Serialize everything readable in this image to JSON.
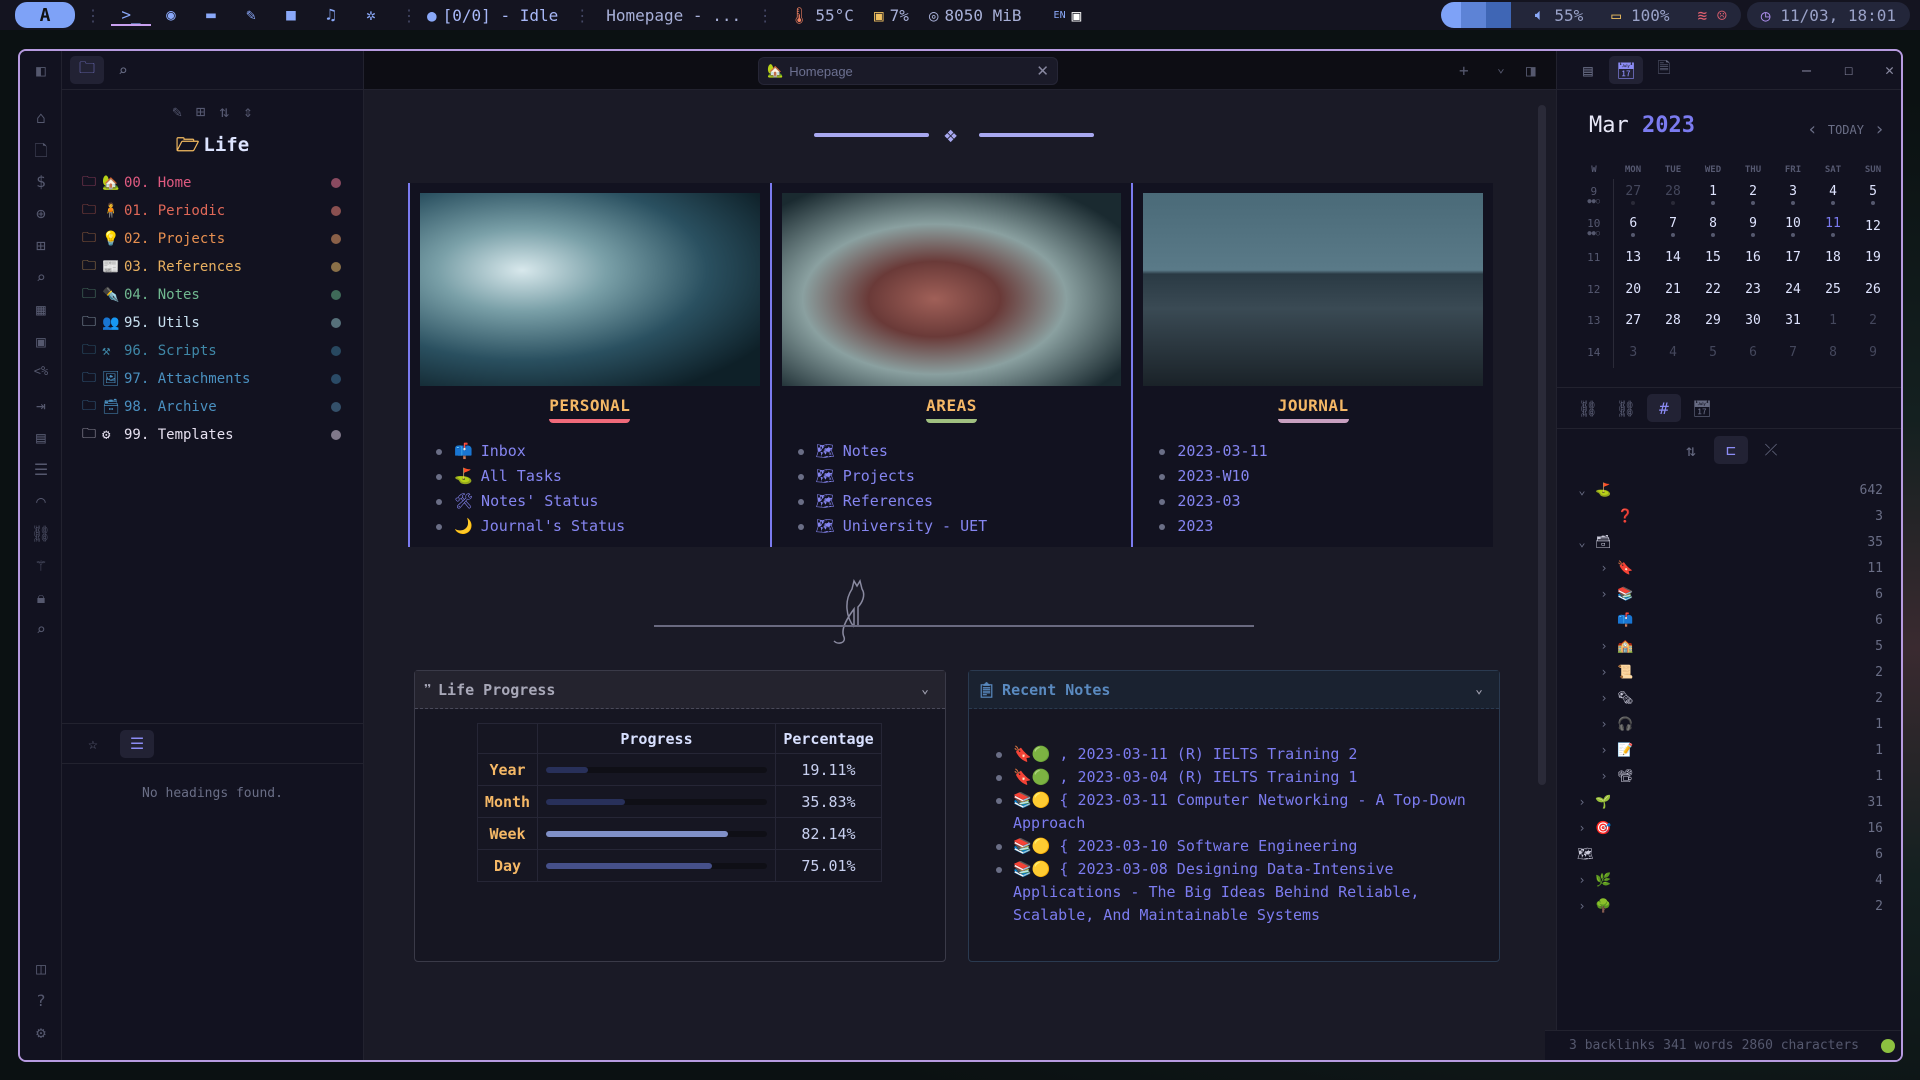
{
  "topbar": {
    "logo": "A",
    "apps": [
      {
        "icon": "terminal-icon",
        "glyph": ">_"
      },
      {
        "icon": "firefox-icon",
        "glyph": "◉"
      },
      {
        "icon": "files-icon",
        "glyph": "▬"
      },
      {
        "icon": "editor-icon",
        "glyph": "✎"
      },
      {
        "icon": "video-icon",
        "glyph": "■"
      },
      {
        "icon": "music-icon",
        "glyph": "♫"
      },
      {
        "icon": "settings-icon",
        "glyph": "✲"
      }
    ],
    "pomodoro": "[0/0] - Idle",
    "window_title": "Homepage - ...",
    "temperature": "55°C",
    "cpu": "7%",
    "memory": "8050 MiB",
    "keyboard_layout": "EN",
    "volume": "55%",
    "battery": "100%",
    "datetime": "11/03, 18:01",
    "colors": {
      "accent": "#7ea2f7",
      "temp": "#f08060",
      "cpu": "#f0c060",
      "wifi_off": "#e06070"
    }
  },
  "left_pane": {
    "vault_name": "Life",
    "folders": [
      {
        "label": "00. Home",
        "emoji": "🏡",
        "color": "#e05a80",
        "dot": "#8a4a60"
      },
      {
        "label": "01. Periodic",
        "emoji": "🧍",
        "color": "#e06858",
        "dot": "#8a5050"
      },
      {
        "label": "02. Projects",
        "emoji": "💡",
        "color": "#e89050",
        "dot": "#8a6048"
      },
      {
        "label": "03. References",
        "emoji": "📰",
        "color": "#e8b060",
        "dot": "#8a7048"
      },
      {
        "label": "04. Notes",
        "emoji": "✒️",
        "color": "#70b890",
        "dot": "#3f6a58"
      },
      {
        "label": "95. Utils",
        "emoji": "👥",
        "color": "#c8e0f0",
        "dot": "#56707a"
      },
      {
        "label": "96. Scripts",
        "emoji": "⚒",
        "color": "#3f88a8",
        "dot": "#284860"
      },
      {
        "label": "97. Attachments",
        "emoji": "🖼",
        "color": "#4a90c0",
        "dot": "#2a4a66"
      },
      {
        "label": "98. Archive",
        "emoji": "🗃",
        "color": "#4a90c0",
        "dot": "#34506a"
      },
      {
        "label": "99. Templates",
        "emoji": "⚙",
        "color": "#e6e0f0",
        "dot": "#80788a"
      }
    ],
    "no_headings": "No headings found."
  },
  "tab": {
    "label": "Homepage",
    "emoji": "🏡"
  },
  "cards": [
    {
      "title": "PERSONAL",
      "underline": "#f06a7a",
      "items": [
        {
          "emoji": "📫",
          "label": "Inbox"
        },
        {
          "emoji": "⛳",
          "label": "All Tasks"
        },
        {
          "emoji": "🛠",
          "label": "Notes' Status"
        },
        {
          "emoji": "🌙",
          "label": "Journal's Status"
        }
      ]
    },
    {
      "title": "AREAS",
      "underline": "#a0c080",
      "items": [
        {
          "emoji": "🗺",
          "label": "Notes"
        },
        {
          "emoji": "🗺",
          "label": "Projects"
        },
        {
          "emoji": "🗺",
          "label": "References"
        },
        {
          "emoji": "🗺",
          "label": "University - UET"
        }
      ]
    },
    {
      "title": "JOURNAL",
      "underline": "#c8a0c0",
      "items": [
        {
          "emoji": "",
          "label": "2023-03-11"
        },
        {
          "emoji": "",
          "label": "2023-W10"
        },
        {
          "emoji": "",
          "label": "2023-03"
        },
        {
          "emoji": "",
          "label": "2023"
        }
      ]
    }
  ],
  "life_progress": {
    "title": "Life Progress",
    "headers": [
      "",
      "Progress",
      "Percentage"
    ],
    "rows": [
      {
        "label": "Year",
        "value": 19.11,
        "text": "19.11%",
        "color": "#28305a"
      },
      {
        "label": "Month",
        "value": 35.83,
        "text": "35.83%",
        "color": "#28305a"
      },
      {
        "label": "Week",
        "value": 82.14,
        "text": "82.14%",
        "color": "#8090c8"
      },
      {
        "label": "Day",
        "value": 75.01,
        "text": "75.01%",
        "color": "#46508a"
      }
    ]
  },
  "recent_notes": {
    "title": "Recent Notes",
    "items": [
      {
        "emoji": "🔖🟢",
        "text": ", 2023-03-11 (R) IELTS Training 2"
      },
      {
        "emoji": "🔖🟢",
        "text": ", 2023-03-04 (R) IELTS Training 1"
      },
      {
        "emoji": "📚🟡",
        "text": "{ 2023-03-11 Computer Networking - A Top-Down Approach"
      },
      {
        "emoji": "📚🟡",
        "text": "{ 2023-03-10 Software Engineering"
      },
      {
        "emoji": "📚🟡",
        "text": "{ 2023-03-08 Designing Data-Intensive Applications - The Big Ideas Behind Reliable, Scalable, And Maintainable Systems"
      }
    ]
  },
  "calendar": {
    "month": "Mar",
    "year": "2023",
    "today_label": "TODAY",
    "weekdays": [
      "W",
      "MON",
      "TUE",
      "WED",
      "THU",
      "FRI",
      "SAT",
      "SUN"
    ],
    "weeks": [
      {
        "wk": "9",
        "days": [
          "27",
          "28",
          "1",
          "2",
          "3",
          "4",
          "5"
        ],
        "dim": [
          0,
          1
        ],
        "dots": true
      },
      {
        "wk": "10",
        "days": [
          "6",
          "7",
          "8",
          "9",
          "10",
          "11",
          "12"
        ],
        "dim": [],
        "dots": true
      },
      {
        "wk": "11",
        "days": [
          "13",
          "14",
          "15",
          "16",
          "17",
          "18",
          "19"
        ],
        "dim": [],
        "dots": false
      },
      {
        "wk": "12",
        "days": [
          "20",
          "21",
          "22",
          "23",
          "24",
          "25",
          "26"
        ],
        "dim": [],
        "dots": false
      },
      {
        "wk": "13",
        "days": [
          "27",
          "28",
          "29",
          "30",
          "31",
          "1",
          "2"
        ],
        "dim": [
          5,
          6
        ],
        "dots": false
      },
      {
        "wk": "14",
        "days": [
          "3",
          "4",
          "5",
          "6",
          "7",
          "8",
          "9"
        ],
        "dim": [
          0,
          1,
          2,
          3,
          4,
          5,
          6
        ],
        "dots": false
      }
    ],
    "today": "11"
  },
  "tags": [
    {
      "emoji": "⛳",
      "count": "642",
      "level": 0,
      "chev": "v"
    },
    {
      "emoji": "❓",
      "count": "3",
      "level": 1,
      "chev": ""
    },
    {
      "emoji": "🗃",
      "count": "35",
      "level": 0,
      "chev": "v"
    },
    {
      "emoji": "🔖",
      "count": "11",
      "level": 1,
      "chev": ">"
    },
    {
      "emoji": "📚",
      "count": "6",
      "level": 1,
      "chev": ">"
    },
    {
      "emoji": "📫",
      "count": "6",
      "level": 1,
      "chev": ""
    },
    {
      "emoji": "🏫",
      "count": "5",
      "level": 1,
      "chev": ">"
    },
    {
      "emoji": "📜",
      "count": "2",
      "level": 1,
      "chev": ">"
    },
    {
      "emoji": "🗞",
      "count": "2",
      "level": 1,
      "chev": ">"
    },
    {
      "emoji": "🎧",
      "count": "1",
      "level": 1,
      "chev": ">"
    },
    {
      "emoji": "📝",
      "count": "1",
      "level": 1,
      "chev": ">"
    },
    {
      "emoji": "📽",
      "count": "1",
      "level": 1,
      "chev": ">"
    },
    {
      "emoji": "🌱",
      "count": "31",
      "level": 0,
      "chev": ">"
    },
    {
      "emoji": "🎯",
      "count": "16",
      "level": 0,
      "chev": ">"
    },
    {
      "emoji": "🗺",
      "count": "6",
      "level": -1,
      "chev": ""
    },
    {
      "emoji": "🌿",
      "count": "4",
      "level": 0,
      "chev": ">"
    },
    {
      "emoji": "🌳",
      "count": "2",
      "level": 0,
      "chev": ">"
    }
  ],
  "statusbar": {
    "backlinks": "3 backlinks",
    "words": "341 words",
    "characters": "2860 characters"
  }
}
